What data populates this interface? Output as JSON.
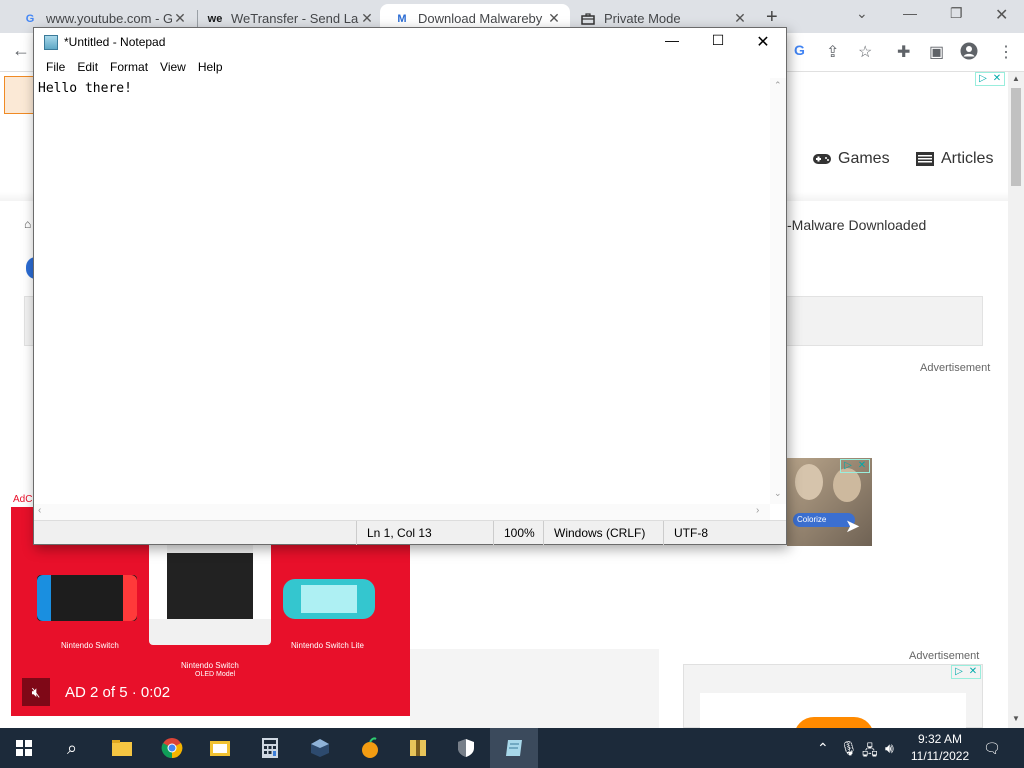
{
  "browser": {
    "tabs": [
      {
        "title": "www.youtube.com - Gr",
        "favicon": "G",
        "favicon_color": "#4285f4"
      },
      {
        "title": "WeTransfer - Send Larg",
        "favicon": "we",
        "favicon_color": "#17181a"
      },
      {
        "title": "Download Malwareby",
        "favicon": "M",
        "favicon_color": "#2b6cd4"
      },
      {
        "title": "Private Mode",
        "favicon": "briefcase-icon",
        "favicon_color": "#333"
      }
    ],
    "new_tab": "+"
  },
  "webpage": {
    "nav": [
      {
        "label": "Games",
        "icon": "gamepad-icon"
      },
      {
        "label": "Articles",
        "icon": "newspaper-icon"
      }
    ],
    "heading_fragment": "-Malware Downloaded",
    "advertisement_label": "Advertisement",
    "advertisement_label_2": "Advertisement",
    "colorize_label": "Colorize"
  },
  "notepad": {
    "title": "*Untitled - Notepad",
    "menu": [
      "File",
      "Edit",
      "Format",
      "View",
      "Help"
    ],
    "content": "Hello there!",
    "status": {
      "position": "Ln 1, Col 13",
      "zoom": "100%",
      "line_ending": "Windows (CRLF)",
      "encoding": "UTF-8"
    }
  },
  "video_ad": {
    "tag": "AdC",
    "counter": "AD 2 of 5 · 0:02",
    "products": [
      "Nintendo Switch",
      "Nintendo Switch",
      "Nintendo Switch Lite"
    ],
    "oled_label": "OLED Model"
  },
  "taskbar": {
    "time": "9:32 AM",
    "date": "11/11/2022"
  }
}
